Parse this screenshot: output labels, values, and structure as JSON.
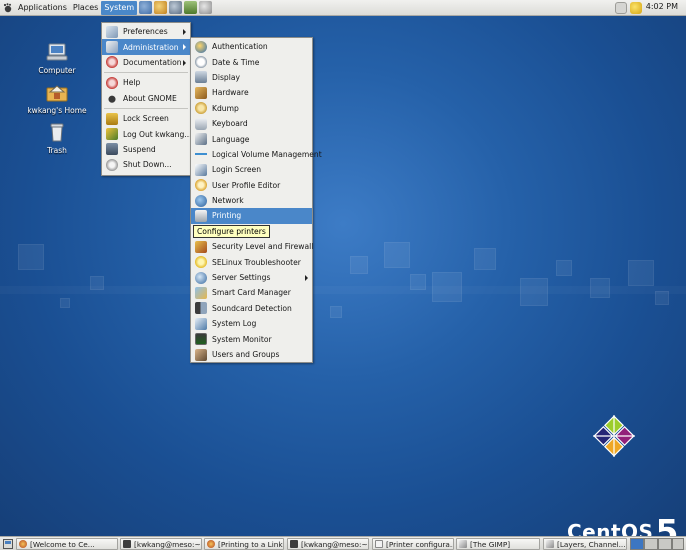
{
  "top_panel": {
    "applications": "Applications",
    "places": "Places",
    "system": "System",
    "clock": "4:02 PM"
  },
  "desktop_icons": [
    {
      "label": "Computer"
    },
    {
      "label": "kwkang's Home"
    },
    {
      "label": "Trash"
    }
  ],
  "system_menu": {
    "items": [
      {
        "label": "Preferences"
      },
      {
        "label": "Administration"
      },
      {
        "label": "Documentation"
      },
      {
        "label": "Help"
      },
      {
        "label": "About GNOME"
      },
      {
        "label": "Lock Screen"
      },
      {
        "label": "Log Out kwkang..."
      },
      {
        "label": "Suspend"
      },
      {
        "label": "Shut Down..."
      }
    ]
  },
  "admin_menu": {
    "items": [
      {
        "label": "Authentication"
      },
      {
        "label": "Date & Time"
      },
      {
        "label": "Display"
      },
      {
        "label": "Hardware"
      },
      {
        "label": "Kdump"
      },
      {
        "label": "Keyboard"
      },
      {
        "label": "Language"
      },
      {
        "label": "Logical Volume Management"
      },
      {
        "label": "Login Screen"
      },
      {
        "label": "User Profile Editor"
      },
      {
        "label": "Network"
      },
      {
        "label": "Printing"
      },
      {
        "label": "Security Level and Firewall"
      },
      {
        "label": "SELinux Troubleshooter"
      },
      {
        "label": "Server Settings"
      },
      {
        "label": "Smart Card Manager"
      },
      {
        "label": "Soundcard Detection"
      },
      {
        "label": "System Log"
      },
      {
        "label": "System Monitor"
      },
      {
        "label": "Users and Groups"
      }
    ]
  },
  "tooltip": "Configure printers",
  "taskbar": [
    {
      "label": "[Welcome to Ce..."
    },
    {
      "label": "[kwkang@meso:~]"
    },
    {
      "label": "[Printing to a Link..."
    },
    {
      "label": "[kwkang@meso:~]"
    },
    {
      "label": "[Printer configura..."
    },
    {
      "label": "[The GIMP]"
    },
    {
      "label": "[Layers, Channel..."
    }
  ],
  "logo": {
    "text": "CentOS",
    "version": "5"
  }
}
